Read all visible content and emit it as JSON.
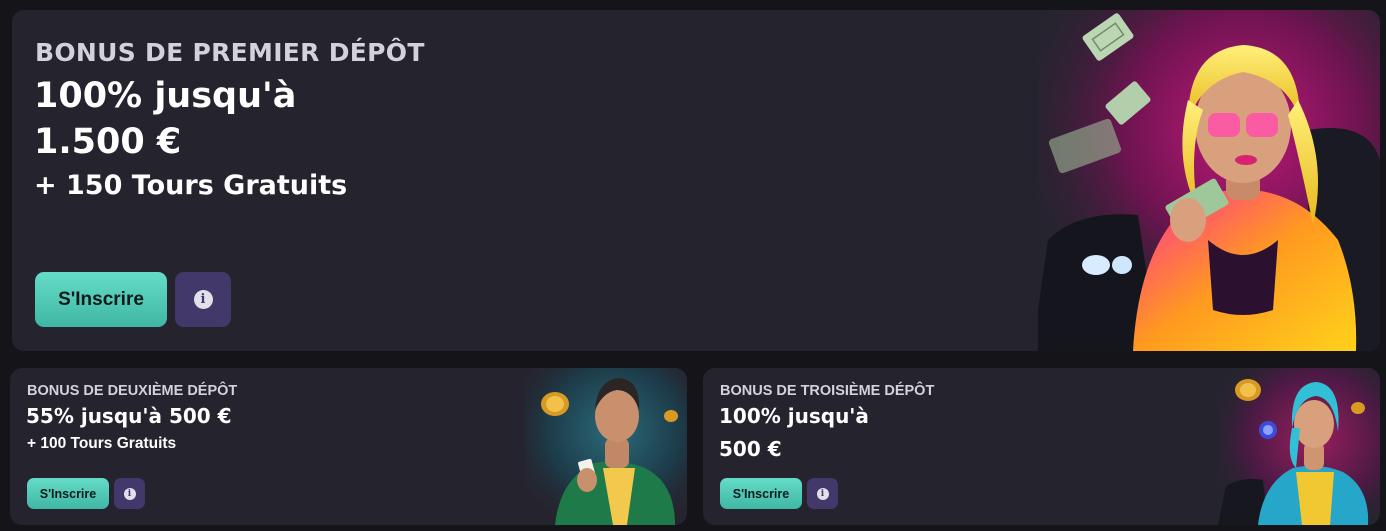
{
  "main_offer": {
    "title": "BONUS DE PREMIER DÉPÔT",
    "line1": "100% jusqu'à",
    "line2": "1.500 €",
    "line3": "+ 150 Tours Gratuits",
    "signup_label": "S'Inscrire",
    "info_glyph": "i"
  },
  "second_offer": {
    "title": "BONUS DE DEUXIÈME DÉPÔT",
    "line1": "55% jusqu'à 500 €",
    "line2": "+ 100 Tours Gratuits",
    "signup_label": "S'Inscrire",
    "info_glyph": "i"
  },
  "third_offer": {
    "title": "BONUS DE TROISIÈME DÉPÔT",
    "line1": "100% jusqu'à",
    "line2": "500 €",
    "signup_label": "S'Inscrire",
    "info_glyph": "i"
  },
  "colors": {
    "page_bg": "#141419",
    "card_bg": "#25242e",
    "signup_button": "#4fc9b5",
    "info_button": "#42396a"
  },
  "icons": [
    "info-icon",
    "banknote-icon",
    "coin-icon"
  ]
}
